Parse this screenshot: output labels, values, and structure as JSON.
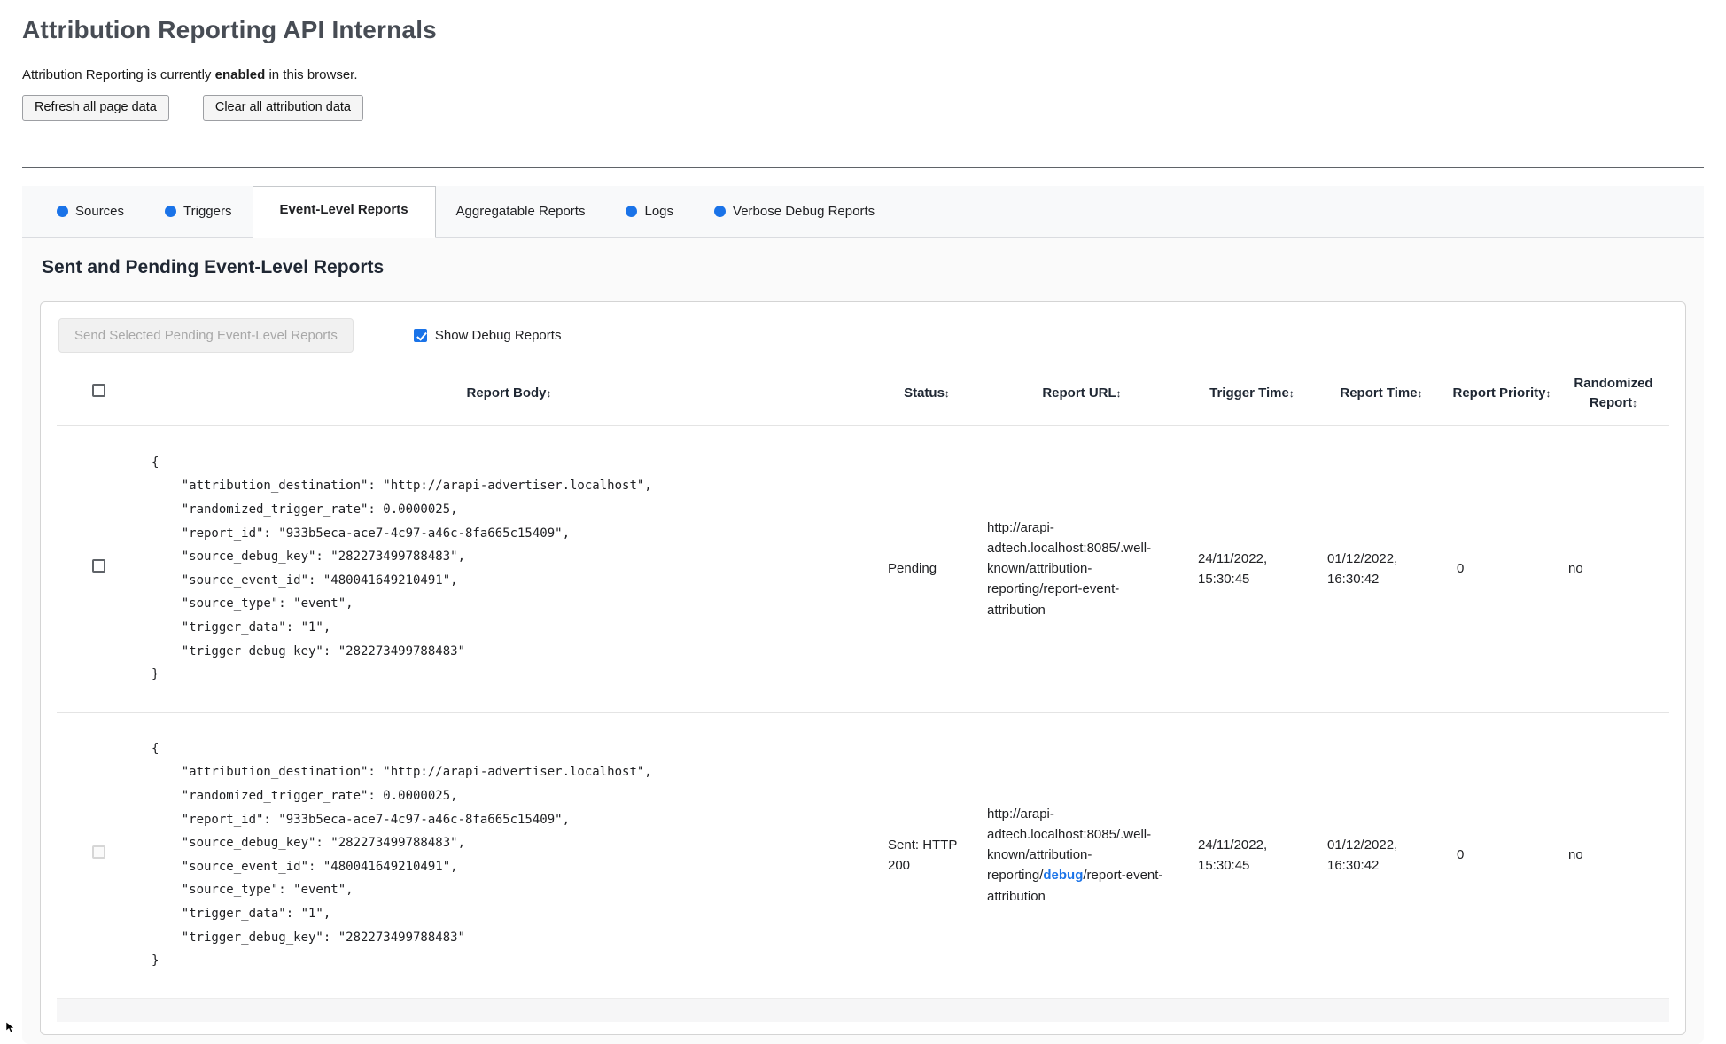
{
  "page": {
    "title": "Attribution Reporting API Internals",
    "status_prefix": "Attribution Reporting is currently ",
    "status_enabled": "enabled",
    "status_suffix": " in this browser.",
    "refresh_button": "Refresh all page data",
    "clear_button": "Clear all attribution data"
  },
  "tabs": {
    "items": [
      {
        "label": "Sources",
        "has_dot": true,
        "active": false
      },
      {
        "label": "Triggers",
        "has_dot": true,
        "active": false
      },
      {
        "label": "Event-Level Reports",
        "has_dot": false,
        "active": true
      },
      {
        "label": "Aggregatable Reports",
        "has_dot": false,
        "active": false
      },
      {
        "label": "Logs",
        "has_dot": true,
        "active": false
      },
      {
        "label": "Verbose Debug Reports",
        "has_dot": true,
        "active": false
      }
    ],
    "dot_color": "#1a73e8"
  },
  "section": {
    "heading": "Sent and Pending Event-Level Reports"
  },
  "toolbar": {
    "send_button_label": "Send Selected Pending Event-Level Reports",
    "send_button_enabled": false,
    "show_debug_label": "Show Debug Reports",
    "show_debug_checked": true
  },
  "table": {
    "select_all_checked": false,
    "sort_icon": "↕",
    "columns": [
      "Report Body",
      "Status",
      "Report URL",
      "Trigger Time",
      "Report Time",
      "Report Priority",
      "Randomized Report"
    ],
    "rows": [
      {
        "selected": false,
        "selectable": true,
        "report_body": "{\n    \"attribution_destination\": \"http://arapi-advertiser.localhost\",\n    \"randomized_trigger_rate\": 0.0000025,\n    \"report_id\": \"933b5eca-ace7-4c97-a46c-8fa665c15409\",\n    \"source_debug_key\": \"282273499788483\",\n    \"source_event_id\": \"480041649210491\",\n    \"source_type\": \"event\",\n    \"trigger_data\": \"1\",\n    \"trigger_debug_key\": \"282273499788483\"\n}",
        "status": "Pending",
        "report_url": "http://arapi-adtech.localhost:8085/.well-known/attribution-reporting/report-event-attribution",
        "trigger_time": "24/11/2022, 15:30:45",
        "report_time": "01/12/2022, 16:30:42",
        "report_priority": "0",
        "randomized_report": "no"
      },
      {
        "selected": false,
        "selectable": false,
        "report_body": "{\n    \"attribution_destination\": \"http://arapi-advertiser.localhost\",\n    \"randomized_trigger_rate\": 0.0000025,\n    \"report_id\": \"933b5eca-ace7-4c97-a46c-8fa665c15409\",\n    \"source_debug_key\": \"282273499788483\",\n    \"source_event_id\": \"480041649210491\",\n    \"source_type\": \"event\",\n    \"trigger_data\": \"1\",\n    \"trigger_debug_key\": \"282273499788483\"\n}",
        "status": "Sent: HTTP 200",
        "report_url_prefix": "http://arapi-adtech.localhost:8085/.well-known/attribution-reporting/",
        "report_url_debug": "debug",
        "report_url_suffix": "/report-event-attribution",
        "trigger_time": "24/11/2022, 15:30:45",
        "report_time": "01/12/2022, 16:30:42",
        "report_priority": "0",
        "randomized_report": "no"
      }
    ]
  },
  "colors": {
    "accent_blue": "#1a73e8",
    "debug_link_blue": "#1a73e8"
  }
}
